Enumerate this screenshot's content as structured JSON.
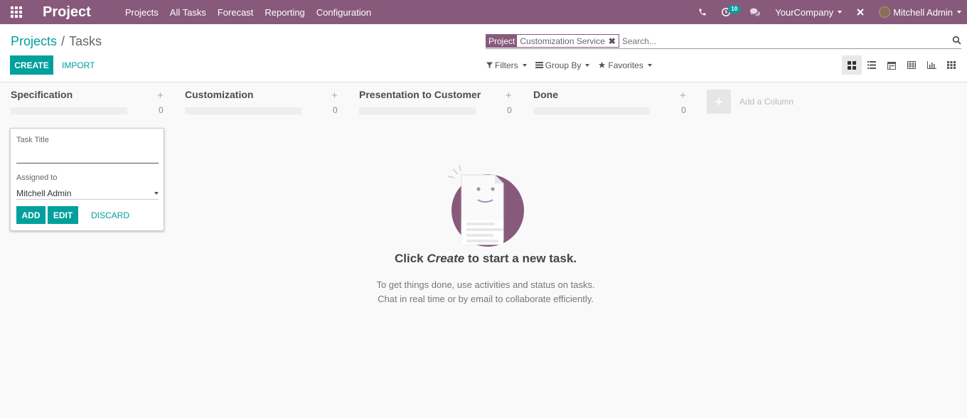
{
  "navbar": {
    "app_title": "Project",
    "menu": [
      "Projects",
      "All Tasks",
      "Forecast",
      "Reporting",
      "Configuration"
    ],
    "activity_count": "10",
    "company": "YourCompany",
    "user": "Mitchell Admin",
    "color": "#875a7b"
  },
  "breadcrumb": {
    "parent": "Projects",
    "separator": "/",
    "current": "Tasks"
  },
  "buttons": {
    "create": "CREATE",
    "import": "IMPORT"
  },
  "search": {
    "facet_category": "Project",
    "facet_value": "Customization Service",
    "placeholder": "Search..."
  },
  "filters": {
    "filters": "Filters",
    "group_by": "Group By",
    "favorites": "Favorites"
  },
  "views": [
    "kanban",
    "list",
    "calendar",
    "pivot",
    "graph",
    "activity"
  ],
  "kanban": {
    "columns": [
      {
        "title": "Specification",
        "count": "0"
      },
      {
        "title": "Customization",
        "count": "0"
      },
      {
        "title": "Presentation to Customer",
        "count": "0"
      },
      {
        "title": "Done",
        "count": "0"
      }
    ],
    "add_column": "Add a Column"
  },
  "quick_create": {
    "task_title_label": "Task Title",
    "task_title_value": "",
    "assigned_label": "Assigned to",
    "assigned_value": "Mitchell Admin",
    "add": "ADD",
    "edit": "EDIT",
    "discard": "DISCARD"
  },
  "helper": {
    "title_prefix": "Click ",
    "title_em": "Create",
    "title_suffix": " to start a new task.",
    "line1": "To get things done, use activities and status on tasks.",
    "line2": "Chat in real time or by email to collaborate efficiently."
  },
  "accent_color": "#00a09d"
}
